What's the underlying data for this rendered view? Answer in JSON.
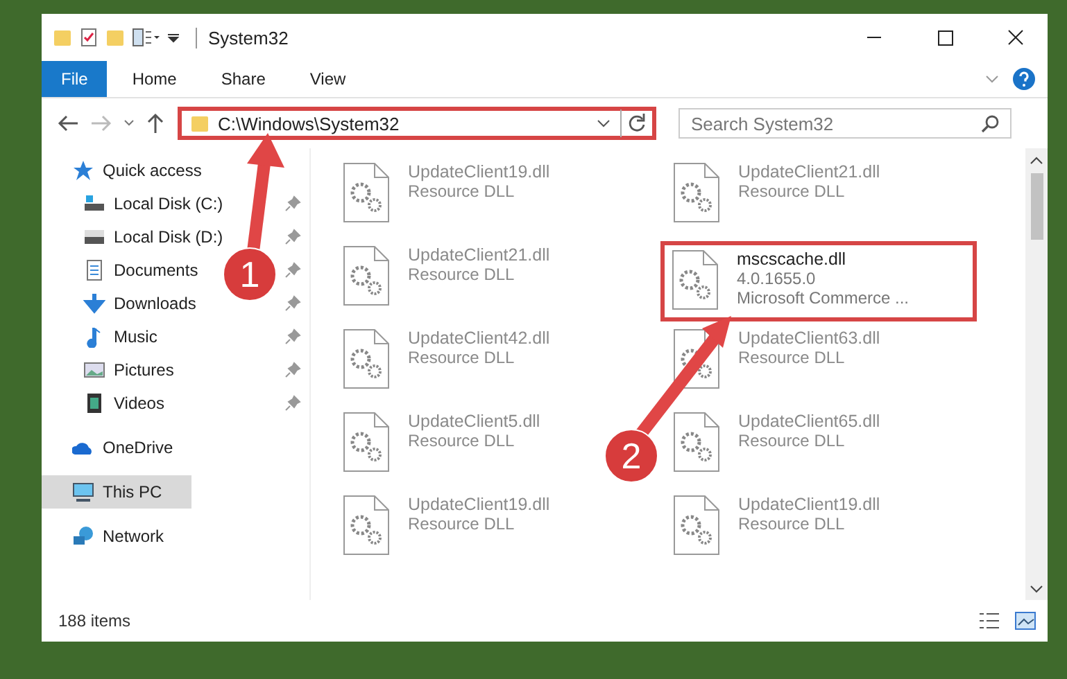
{
  "window": {
    "title": "System32"
  },
  "ribbon": {
    "tabs": [
      {
        "label": "File",
        "selected": true
      },
      {
        "label": "Home",
        "selected": false
      },
      {
        "label": "Share",
        "selected": false
      },
      {
        "label": "View",
        "selected": false
      }
    ]
  },
  "address": {
    "path": "C:\\Windows\\System32",
    "highlighted": true
  },
  "search": {
    "placeholder": "Search System32"
  },
  "sidebar": {
    "items": [
      {
        "label": "Quick access",
        "kind": "group",
        "selected": false,
        "pinned": false
      },
      {
        "label": "Local Disk (C:)",
        "kind": "item",
        "selected": false,
        "pinned": true
      },
      {
        "label": "Local Disk (D:)",
        "kind": "item",
        "selected": false,
        "pinned": true
      },
      {
        "label": "Documents",
        "kind": "item",
        "selected": false,
        "pinned": true
      },
      {
        "label": "Downloads",
        "kind": "item",
        "selected": false,
        "pinned": true
      },
      {
        "label": "Music",
        "kind": "item",
        "selected": false,
        "pinned": true
      },
      {
        "label": "Pictures",
        "kind": "item",
        "selected": false,
        "pinned": true
      },
      {
        "label": "Videos",
        "kind": "item",
        "selected": false,
        "pinned": true
      },
      {
        "label": "OneDrive",
        "kind": "group",
        "selected": false,
        "pinned": false
      },
      {
        "label": "This PC",
        "kind": "group",
        "selected": true,
        "pinned": false
      },
      {
        "label": "Network",
        "kind": "group",
        "selected": false,
        "pinned": false
      }
    ]
  },
  "files": [
    {
      "name": "UpdateClient19.dll",
      "lines": [
        "Resource DLL"
      ],
      "highlighted": false
    },
    {
      "name": "UpdateClient21.dll",
      "lines": [
        "Resource DLL"
      ],
      "highlighted": false
    },
    {
      "name": "UpdateClient21.dll",
      "lines": [
        "Resource DLL"
      ],
      "highlighted": false
    },
    {
      "name": "mscscache.dll",
      "lines": [
        "4.0.1655.0",
        "Microsoft Commerce ..."
      ],
      "highlighted": true
    },
    {
      "name": "UpdateClient42.dll",
      "lines": [
        "Resource DLL"
      ],
      "highlighted": false
    },
    {
      "name": "UpdateClient63.dll",
      "lines": [
        "Resource DLL"
      ],
      "highlighted": false
    },
    {
      "name": "UpdateClient5.dll",
      "lines": [
        "Resource DLL"
      ],
      "highlighted": false
    },
    {
      "name": "UpdateClient65.dll",
      "lines": [
        "Resource DLL"
      ],
      "highlighted": false
    },
    {
      "name": "UpdateClient19.dll",
      "lines": [
        "Resource DLL"
      ],
      "highlighted": false
    },
    {
      "name": "UpdateClient19.dll",
      "lines": [
        "Resource DLL"
      ],
      "highlighted": false
    }
  ],
  "status_bar": {
    "count": "188 items"
  },
  "annotations": [
    {
      "number": "1"
    },
    {
      "number": "2"
    }
  ]
}
